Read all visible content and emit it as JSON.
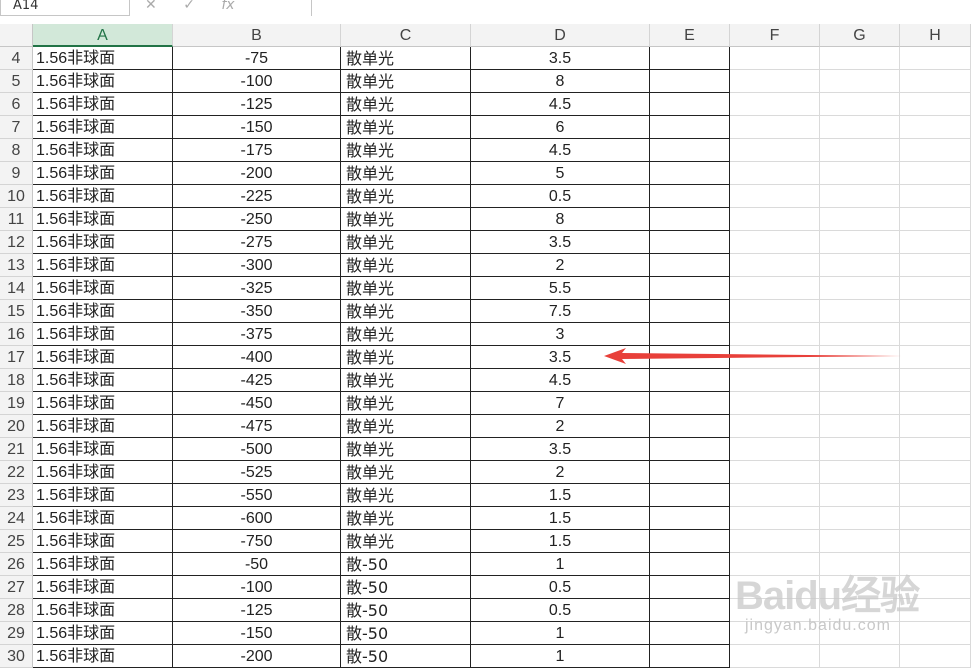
{
  "formula_bar": {
    "name_box": "A14",
    "fx_label": "fx",
    "formula": ""
  },
  "columns": [
    "A",
    "B",
    "C",
    "D",
    "E",
    "F",
    "G",
    "H"
  ],
  "selected_column": "A",
  "rows": [
    {
      "n": "4",
      "a": "1.56非球面",
      "b": "-75",
      "c": "散单光",
      "d": "3.5"
    },
    {
      "n": "5",
      "a": "1.56非球面",
      "b": "-100",
      "c": "散单光",
      "d": "8"
    },
    {
      "n": "6",
      "a": "1.56非球面",
      "b": "-125",
      "c": "散单光",
      "d": "4.5"
    },
    {
      "n": "7",
      "a": "1.56非球面",
      "b": "-150",
      "c": "散单光",
      "d": "6"
    },
    {
      "n": "8",
      "a": "1.56非球面",
      "b": "-175",
      "c": "散单光",
      "d": "4.5"
    },
    {
      "n": "9",
      "a": "1.56非球面",
      "b": "-200",
      "c": "散单光",
      "d": "5"
    },
    {
      "n": "10",
      "a": "1.56非球面",
      "b": "-225",
      "c": "散单光",
      "d": "0.5"
    },
    {
      "n": "11",
      "a": "1.56非球面",
      "b": "-250",
      "c": "散单光",
      "d": "8"
    },
    {
      "n": "12",
      "a": "1.56非球面",
      "b": "-275",
      "c": "散单光",
      "d": "3.5"
    },
    {
      "n": "13",
      "a": "1.56非球面",
      "b": "-300",
      "c": "散单光",
      "d": "2"
    },
    {
      "n": "14",
      "a": "1.56非球面",
      "b": "-325",
      "c": "散单光",
      "d": "5.5"
    },
    {
      "n": "15",
      "a": "1.56非球面",
      "b": "-350",
      "c": "散单光",
      "d": "7.5"
    },
    {
      "n": "16",
      "a": "1.56非球面",
      "b": "-375",
      "c": "散单光",
      "d": "3"
    },
    {
      "n": "17",
      "a": "1.56非球面",
      "b": "-400",
      "c": "散单光",
      "d": "3.5"
    },
    {
      "n": "18",
      "a": "1.56非球面",
      "b": "-425",
      "c": "散单光",
      "d": "4.5"
    },
    {
      "n": "19",
      "a": "1.56非球面",
      "b": "-450",
      "c": "散单光",
      "d": "7"
    },
    {
      "n": "20",
      "a": "1.56非球面",
      "b": "-475",
      "c": "散单光",
      "d": "2"
    },
    {
      "n": "21",
      "a": "1.56非球面",
      "b": "-500",
      "c": "散单光",
      "d": "3.5"
    },
    {
      "n": "22",
      "a": "1.56非球面",
      "b": "-525",
      "c": "散单光",
      "d": "2"
    },
    {
      "n": "23",
      "a": "1.56非球面",
      "b": "-550",
      "c": "散单光",
      "d": "1.5"
    },
    {
      "n": "24",
      "a": "1.56非球面",
      "b": "-600",
      "c": "散单光",
      "d": "1.5"
    },
    {
      "n": "25",
      "a": "1.56非球面",
      "b": "-750",
      "c": "散单光",
      "d": "1.5"
    },
    {
      "n": "26",
      "a": "1.56非球面",
      "b": "-50",
      "c": "散-50",
      "d": "1"
    },
    {
      "n": "27",
      "a": "1.56非球面",
      "b": "-100",
      "c": "散-50",
      "d": "0.5"
    },
    {
      "n": "28",
      "a": "1.56非球面",
      "b": "-125",
      "c": "散-50",
      "d": "0.5"
    },
    {
      "n": "29",
      "a": "1.56非球面",
      "b": "-150",
      "c": "散-50",
      "d": "1"
    },
    {
      "n": "30",
      "a": "1.56非球面",
      "b": "-200",
      "c": "散-50",
      "d": "1"
    }
  ],
  "annotation": {
    "arrow_color": "#e8403a",
    "points_to_row": "17"
  },
  "watermark": {
    "logo": "Baidu经验",
    "sub": "jingyan.baidu.com"
  },
  "colors": {
    "selected_header_bg": "#d2e8d9",
    "selected_header_text": "#217346",
    "grid_line": "#222222"
  }
}
